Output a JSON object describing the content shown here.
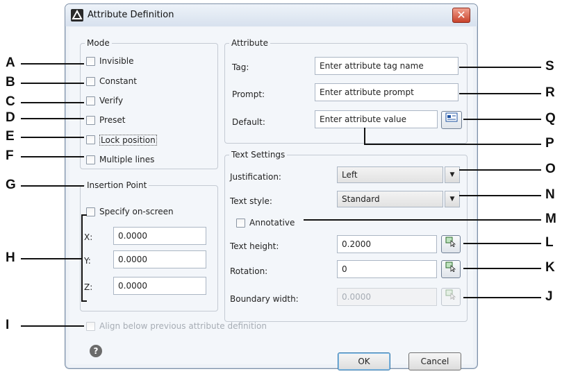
{
  "dialog": {
    "title": "Attribute Definition",
    "close_glyph": "✕"
  },
  "mode": {
    "legend": "Mode",
    "options": [
      {
        "label": "Invisible",
        "checked": false
      },
      {
        "label": "Constant",
        "checked": false
      },
      {
        "label": "Verify",
        "checked": false
      },
      {
        "label": "Preset",
        "checked": false
      },
      {
        "label": "Lock position",
        "checked": false
      },
      {
        "label": "Multiple lines",
        "checked": false
      }
    ]
  },
  "insertion": {
    "legend": "Insertion Point",
    "specify_label": "Specify on-screen",
    "x_label": "X:",
    "x_value": "0.0000",
    "y_label": "Y:",
    "y_value": "0.0000",
    "z_label": "Z:",
    "z_value": "0.0000"
  },
  "attribute": {
    "legend": "Attribute",
    "tag_label": "Tag:",
    "tag_value": "Enter attribute tag name",
    "prompt_label": "Prompt:",
    "prompt_value": "Enter attribute prompt",
    "default_label": "Default:",
    "default_value": "Enter attribute value"
  },
  "text_settings": {
    "legend": "Text Settings",
    "justification_label": "Justification:",
    "justification_value": "Left",
    "style_label": "Text style:",
    "style_value": "Standard",
    "annotative_label": "Annotative",
    "height_label": "Text height:",
    "height_value": "0.2000",
    "rotation_label": "Rotation:",
    "rotation_value": "0",
    "boundary_label": "Boundary width:",
    "boundary_value": "0.0000"
  },
  "align_label": "Align below previous attribute definition",
  "buttons": {
    "ok": "OK",
    "cancel": "Cancel",
    "help_glyph": "?"
  },
  "callouts": {
    "left": [
      "A",
      "B",
      "C",
      "D",
      "E",
      "F",
      "G",
      "H",
      "I"
    ],
    "right": [
      "S",
      "R",
      "Q",
      "P",
      "O",
      "N",
      "M",
      "L",
      "K",
      "J"
    ]
  },
  "colors": {
    "accent": "#3c7fb1",
    "close": "#c8422b"
  }
}
